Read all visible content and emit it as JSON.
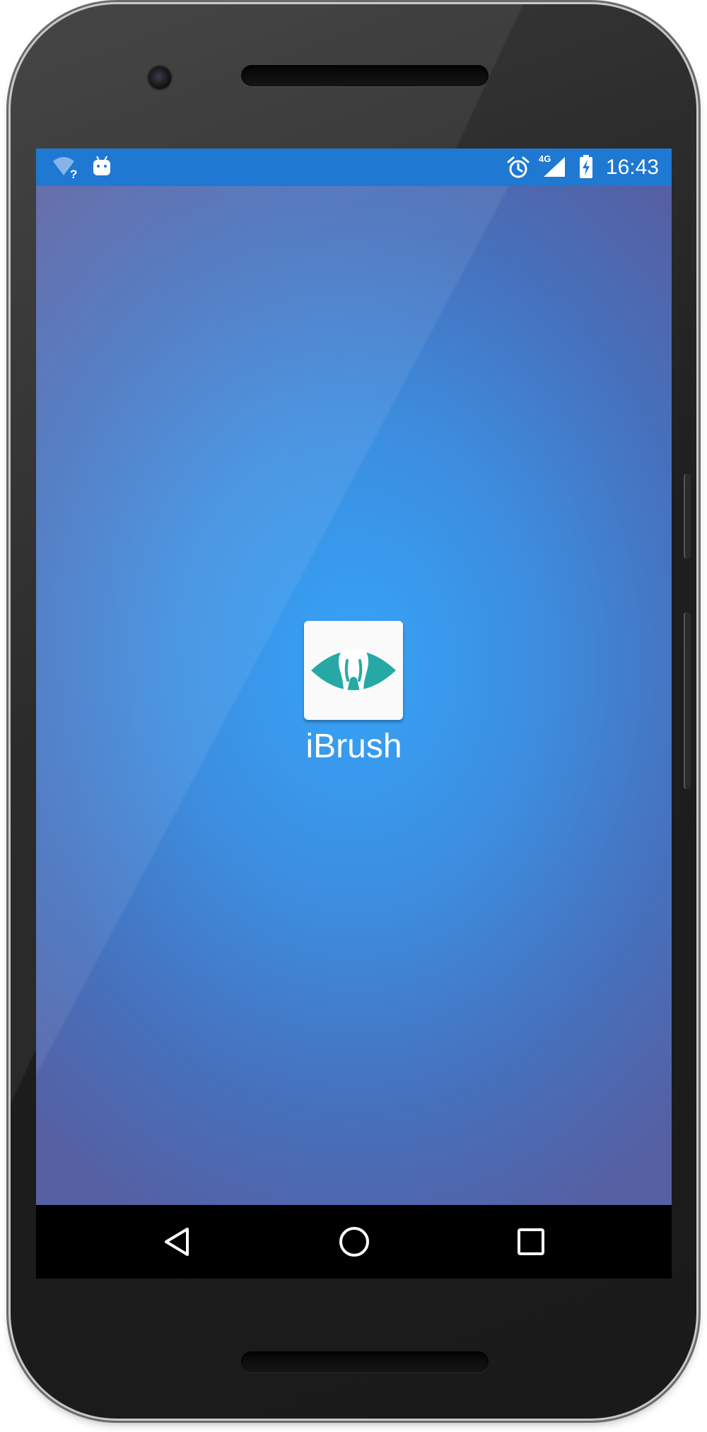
{
  "status_bar": {
    "time": "16:43",
    "network_label": "4G",
    "icons": [
      "wifi-unknown-icon",
      "android-debug-icon",
      "alarm-icon",
      "cell-signal-icon",
      "battery-charging-icon"
    ]
  },
  "app": {
    "name": "iBrush",
    "icon": "tooth-eye-icon",
    "accent_color": "#26a9a5",
    "background_center": "#35a3f7",
    "background_edge": "#5560a3"
  },
  "navigation_bar": {
    "buttons": [
      "back-icon",
      "home-icon",
      "recents-icon"
    ]
  }
}
